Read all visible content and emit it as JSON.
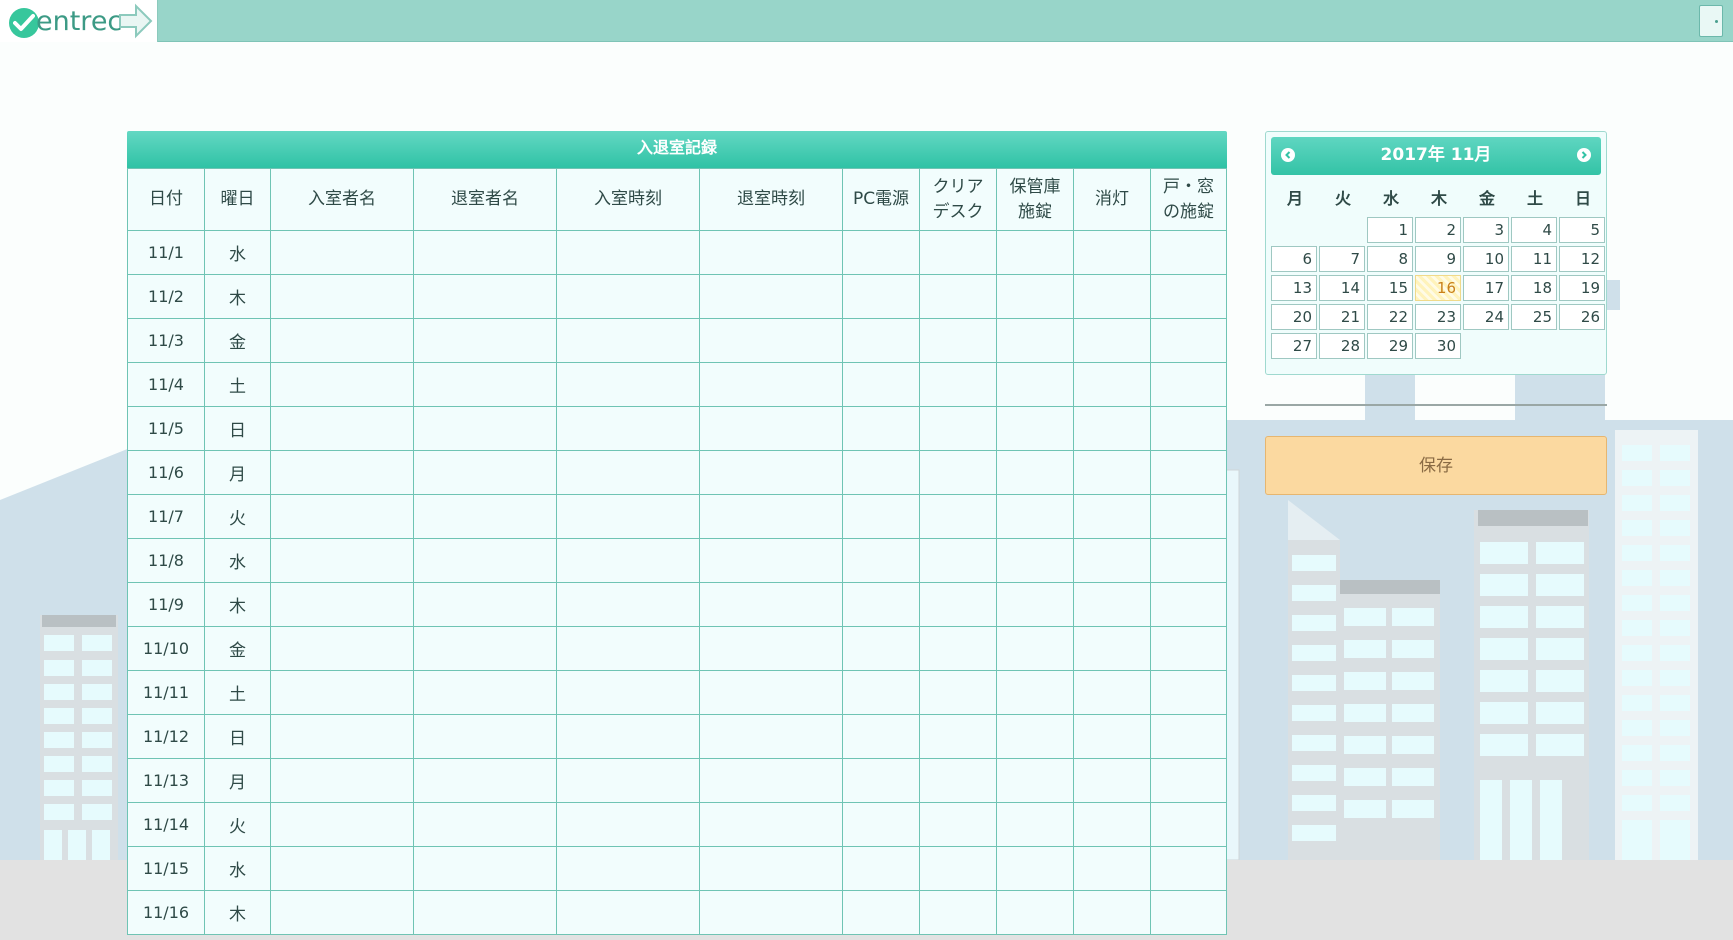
{
  "app": {
    "logo_text": "entrec"
  },
  "records": {
    "title": "入退室記録",
    "columns": [
      "日付",
      "曜日",
      "入室者名",
      "退室者名",
      "入室時刻",
      "退室時刻",
      "PC電源",
      "クリア\nデスク",
      "保管庫\n施錠",
      "消灯",
      "戸・窓\nの施錠"
    ],
    "rows": [
      {
        "date": "11/1",
        "weekday": "水"
      },
      {
        "date": "11/2",
        "weekday": "木"
      },
      {
        "date": "11/3",
        "weekday": "金"
      },
      {
        "date": "11/4",
        "weekday": "土"
      },
      {
        "date": "11/5",
        "weekday": "日"
      },
      {
        "date": "11/6",
        "weekday": "月"
      },
      {
        "date": "11/7",
        "weekday": "火"
      },
      {
        "date": "11/8",
        "weekday": "水"
      },
      {
        "date": "11/9",
        "weekday": "木"
      },
      {
        "date": "11/10",
        "weekday": "金"
      },
      {
        "date": "11/11",
        "weekday": "土"
      },
      {
        "date": "11/12",
        "weekday": "日"
      },
      {
        "date": "11/13",
        "weekday": "月"
      },
      {
        "date": "11/14",
        "weekday": "火"
      },
      {
        "date": "11/15",
        "weekday": "水"
      },
      {
        "date": "11/16",
        "weekday": "木"
      }
    ]
  },
  "calendar": {
    "title": "2017年 11月",
    "weekdays": [
      "月",
      "火",
      "水",
      "木",
      "金",
      "土",
      "日"
    ],
    "leading_blanks": 2,
    "days": [
      "1",
      "2",
      "3",
      "4",
      "5",
      "6",
      "7",
      "8",
      "9",
      "10",
      "11",
      "12",
      "13",
      "14",
      "15",
      "16",
      "17",
      "18",
      "19",
      "20",
      "21",
      "22",
      "23",
      "24",
      "25",
      "26",
      "27",
      "28",
      "29",
      "30"
    ],
    "today": "16"
  },
  "actions": {
    "save_label": "保存"
  },
  "colors": {
    "accent": "#33c3a6",
    "topbar": "#98d5c9",
    "save_button": "#fbd9a0",
    "today_highlight": "#fff3bb"
  }
}
